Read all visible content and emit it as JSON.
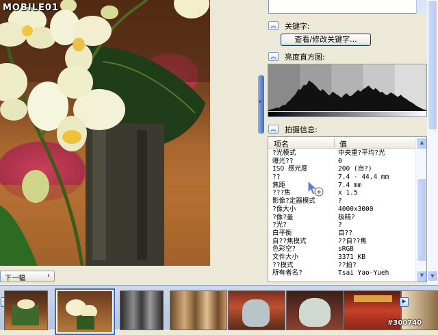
{
  "watermark_logo": "MOBILE01",
  "viewer": {
    "next_button_label": "下一幅",
    "next_arrow": "›"
  },
  "panel": {
    "keywords_header": "关键字:",
    "keywords_button": "查看/修改关键字...",
    "histogram_header": "亮度直方图:",
    "info_header": "拍摄信息:",
    "toggle_icon": "︽",
    "splitter_arrow": "›"
  },
  "info_table": {
    "col_item": "项名",
    "col_value": "值",
    "rows": [
      {
        "k": "?光模式",
        "v": "中央重?平均?光"
      },
      {
        "k": "曝光??",
        "v": "0"
      },
      {
        "k": "ISO 感光度",
        "v": "200 (自?)"
      },
      {
        "k": "??",
        "v": "7.4 - 44.4 mm"
      },
      {
        "k": "焦距",
        "v": "7.4 mm"
      },
      {
        "k": "???焦",
        "v": "x 1.5"
      },
      {
        "k": "影像?定器模式",
        "v": "?"
      },
      {
        "k": "?像大小",
        "v": "4000x3000"
      },
      {
        "k": "?像?量",
        "v": "极精?"
      },
      {
        "k": "?光?",
        "v": "?"
      },
      {
        "k": "白平衡",
        "v": "自??"
      },
      {
        "k": "自??焦模式",
        "v": "??自??焦"
      },
      {
        "k": "色彩空?",
        "v": "sRGB"
      },
      {
        "k": "文件大小",
        "v": "3371 KB"
      },
      {
        "k": "??模式",
        "v": "??拍?"
      },
      {
        "k": "所有者名?",
        "v": "Tsai Yao-Yueh"
      }
    ]
  },
  "histogram": {
    "levels": [
      2,
      3,
      4,
      5,
      6,
      8,
      7,
      9,
      12,
      14,
      13,
      18,
      22,
      25,
      30,
      34,
      38,
      45,
      50,
      48,
      55,
      60,
      58,
      62,
      70,
      66,
      64,
      60,
      57,
      52,
      48,
      45,
      50,
      46,
      42,
      38,
      35,
      40,
      44,
      41,
      38,
      36,
      33,
      30,
      34,
      38,
      40,
      37,
      33,
      35,
      38,
      42,
      45,
      48,
      44,
      46,
      50,
      52,
      55,
      58,
      54,
      50,
      48,
      52,
      49,
      45,
      42,
      44,
      40,
      37,
      36,
      39,
      42,
      40,
      38,
      35,
      32,
      34,
      37,
      33,
      30,
      28,
      25,
      22,
      20,
      18,
      15,
      12,
      10,
      8,
      6,
      4,
      3,
      2
    ]
  },
  "filmstrip": {
    "prev_icon": "◀",
    "next_icon": "▶",
    "watermark": "#300740"
  }
}
